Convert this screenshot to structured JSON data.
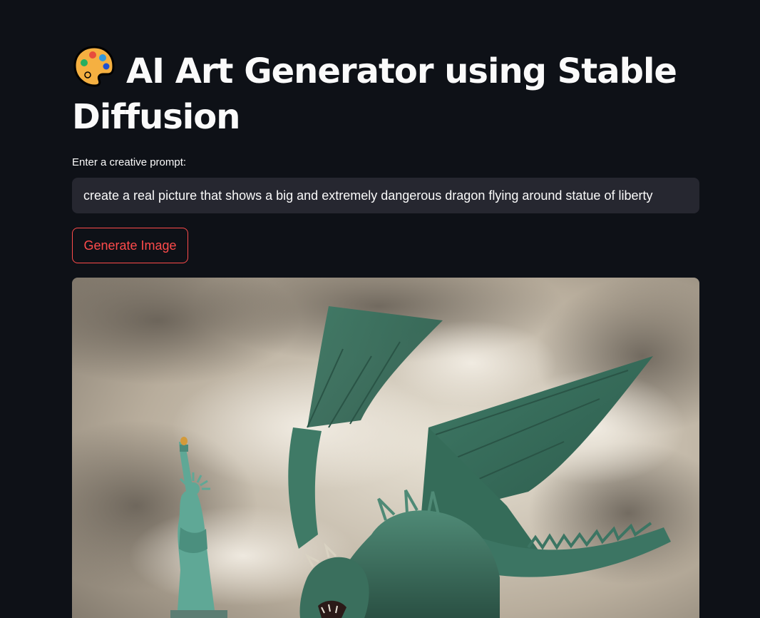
{
  "page": {
    "title": "AI Art Generator using Stable Diffusion",
    "title_icon": "palette-icon"
  },
  "form": {
    "prompt_label": "Enter a creative prompt:",
    "prompt_value": "create a real picture that shows a big and extremely dangerous dragon flying around statue of liberty",
    "generate_button_label": "Generate Image"
  },
  "output": {
    "image_icon": "generated-image",
    "image_subject": "dragon-and-statue-of-liberty"
  },
  "colors": {
    "background": "#0e1117",
    "input_background": "#262730",
    "accent": "#ff4b4b",
    "text": "#fafafa"
  }
}
